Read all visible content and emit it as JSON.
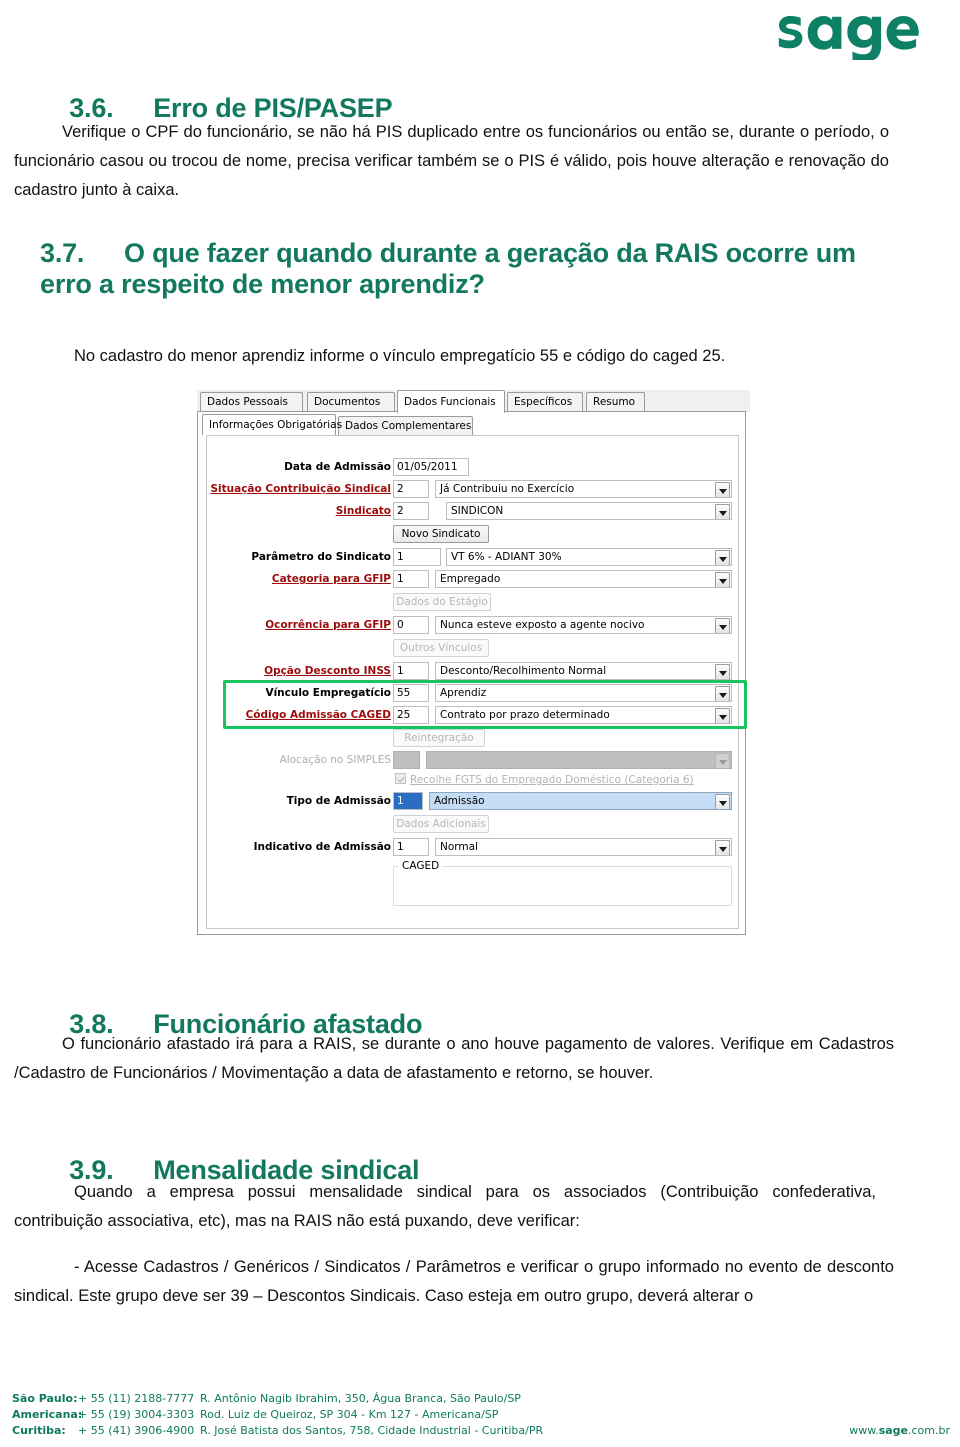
{
  "brand": {
    "logo_text": "sage",
    "green": "#12795E",
    "footer_green": "#0e7a5f",
    "highlight_green": "#19c45a"
  },
  "sections": [
    {
      "number": "3.6.",
      "title": "Erro de PIS/PASEP",
      "body": "Verifique o CPF do funcionário, se não há PIS duplicado entre os funcionários ou então se, durante o período, o funcionário casou ou trocou de nome, precisa verificar também se o PIS é válido, pois houve alteração e renovação do cadastro junto à caixa."
    },
    {
      "number": "3.7.",
      "title": "O que fazer quando durante a geração da RAIS ocorre um erro a respeito de menor aprendiz?",
      "body": "No cadastro do menor aprendiz informe o vínculo empregatício 55 e código do caged 25."
    },
    {
      "number": "3.8.",
      "title": "Funcionário afastado",
      "body": "O funcionário afastado irá para a RAIS, se durante o ano houve pagamento de valores. Verifique em Cadastros /Cadastro de Funcionários / Movimentação a data de afastamento e retorno, se houver."
    },
    {
      "number": "3.9.",
      "title": "Mensalidade sindical",
      "body": "Quando a empresa possui mensalidade sindical para os associados (Contribuição confederativa, contribuição associativa, etc), mas na RAIS não está puxando, deve verificar:",
      "body2": "- Acesse Cadastros / Genéricos / Sindicatos / Parâmetros e verificar o grupo informado no evento de desconto sindical. Este grupo deve ser 39 – Descontos Sindicais. Caso esteja em outro grupo, deverá alterar o"
    }
  ],
  "app_screenshot": {
    "outer_tabs": [
      {
        "label": "Dados Pessoais",
        "selected": false
      },
      {
        "label": "Documentos",
        "selected": false
      },
      {
        "label": "Dados Funcionais",
        "selected": true
      },
      {
        "label": "Específicos",
        "selected": false
      },
      {
        "label": "Resumo",
        "selected": false
      }
    ],
    "inner_tabs": [
      {
        "label": "Informações Obrigatórias",
        "selected": true
      },
      {
        "label": "Dados Complementares",
        "selected": false
      }
    ],
    "fields": {
      "data_admissao": {
        "label": "Data de Admissão",
        "value": "01/05/2011"
      },
      "situacao_contribuicao_sindical": {
        "label": "Situação Contribuição Sindical",
        "code": "2",
        "desc": "Já Contribuiu no Exercício"
      },
      "sindicato": {
        "label": "Sindicato",
        "code": "2",
        "desc": "SINDICON"
      },
      "parametro_sindicato": {
        "label": "Parâmetro do Sindicato",
        "code": "1",
        "desc": "VT 6% - ADIANT 30%"
      },
      "categoria_gfip": {
        "label": "Categoria para GFIP",
        "code": "1",
        "desc": "Empregado"
      },
      "ocorrencia_gfip": {
        "label": "Ocorrência para GFIP",
        "code": "0",
        "desc": "Nunca esteve exposto a agente nocivo"
      },
      "opcao_desconto_inss": {
        "label": "Opção Desconto INSS",
        "code": "1",
        "desc": "Desconto/Recolhimento Normal"
      },
      "vinculo_empregaticio": {
        "label": "Vínculo Empregatício",
        "code": "55",
        "desc": "Aprendiz"
      },
      "codigo_admissao_caged": {
        "label": "Código Admissão CAGED",
        "code": "25",
        "desc": "Contrato por prazo determinado"
      },
      "alocacao_simples": {
        "label": "Alocação no SIMPLES",
        "code": "",
        "desc": ""
      },
      "tipo_admissao": {
        "label": "Tipo de Admissão",
        "code": "1",
        "desc": "Admissão"
      },
      "indicativo_admissao": {
        "label": "Indicativo de Admissão",
        "code": "1",
        "desc": "Normal"
      }
    },
    "buttons": {
      "novo_sindicato": "Novo Sindicato",
      "dados_estagio": "Dados do Estágio",
      "outros_vinculos": "Outros Vínculos",
      "reintegracao": "Reintegração",
      "dados_adicionais": "Dados Adicionais"
    },
    "checkbox_fgts": {
      "label": "Recolhe FGTS do Empregado Doméstico (Categoria 6)",
      "checked": true
    },
    "group_caged": {
      "label": "CAGED"
    }
  },
  "footer": {
    "offices": [
      {
        "city": "São Paulo:",
        "phone": "+ 55 (11) 2188-7777",
        "address": "R. Antônio Nagib Ibrahim, 350, Água Branca, São Paulo/SP"
      },
      {
        "city": "Americana:",
        "phone": "+ 55 (19) 3004-3303",
        "address": "Rod. Luiz de Queiroz, SP 304 - Km 127 - Americana/SP"
      },
      {
        "city": "Curitiba:",
        "phone": "+ 55 (41) 3906-4900",
        "address": "R. José Batista dos Santos, 758, Cidade Industrial - Curitiba/PR"
      }
    ],
    "site_prefix": "www.",
    "site_bold": "sage",
    "site_suffix": ".com.br"
  }
}
